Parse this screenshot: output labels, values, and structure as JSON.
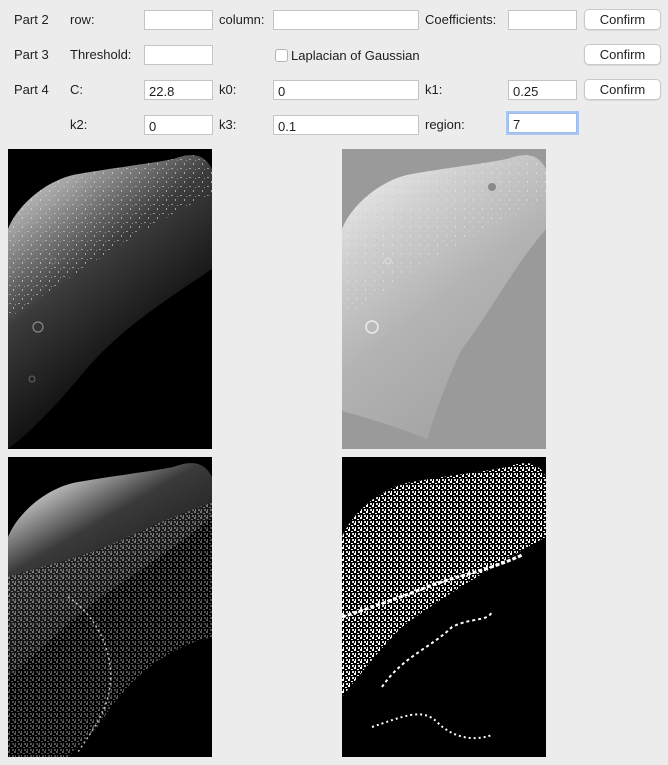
{
  "part2": {
    "label": "Part 2",
    "row_label": "row:",
    "row_value": "",
    "column_label": "column:",
    "column_value": "",
    "coefficients_label": "Coefficients:",
    "coefficients_value": "",
    "confirm": "Confirm"
  },
  "part3": {
    "label": "Part 3",
    "threshold_label": "Threshold:",
    "threshold_value": "",
    "log_label": "Laplacian of Gaussian",
    "log_checked": false,
    "confirm": "Confirm"
  },
  "part4": {
    "label": "Part 4",
    "c_label": "C:",
    "c_value": "22.8",
    "k0_label": "k0:",
    "k0_value": "0",
    "k1_label": "k1:",
    "k1_value": "0.25",
    "k2_label": "k2:",
    "k2_value": "0",
    "k3_label": "k3:",
    "k3_value": "0.1",
    "region_label": "region:",
    "region_value": "7",
    "confirm": "Confirm"
  },
  "images": [
    {
      "name": "original",
      "background": "#000000"
    },
    {
      "name": "processed-gray",
      "background": "#9a9a9a"
    },
    {
      "name": "enhanced",
      "background": "#000000"
    },
    {
      "name": "binary-mask",
      "background": "#000000"
    }
  ]
}
